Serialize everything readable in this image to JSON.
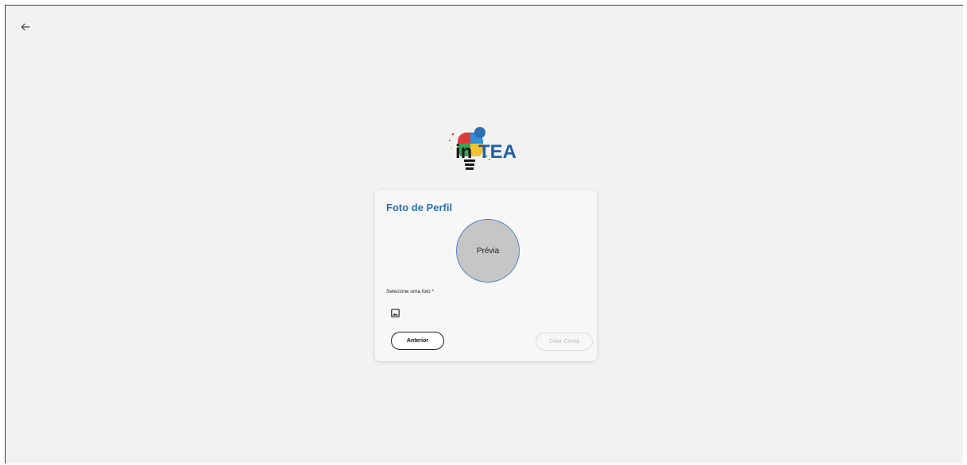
{
  "nav": {
    "back_icon": "arrow-left-icon"
  },
  "logo": {
    "text_in": "in",
    "text_tea": "TEA",
    "icon": "lightbulb-puzzle-logo",
    "colors": {
      "blue": "#1f5fa5",
      "dark": "#1a1a1a",
      "red": "#e03a3a",
      "yellow": "#f2c230",
      "green": "#3aa655",
      "light_blue": "#5aa0e0"
    }
  },
  "card": {
    "title": "Foto de Perfil",
    "preview_label": "Prévia",
    "field_label": "Selecione uma foto *",
    "file_icon": "image-icon",
    "prev_button": "Anterior",
    "create_button": "Criar Conta",
    "create_enabled": false
  },
  "theme": {
    "accent": "#2f6fb0",
    "background": "#f2f2f2"
  }
}
